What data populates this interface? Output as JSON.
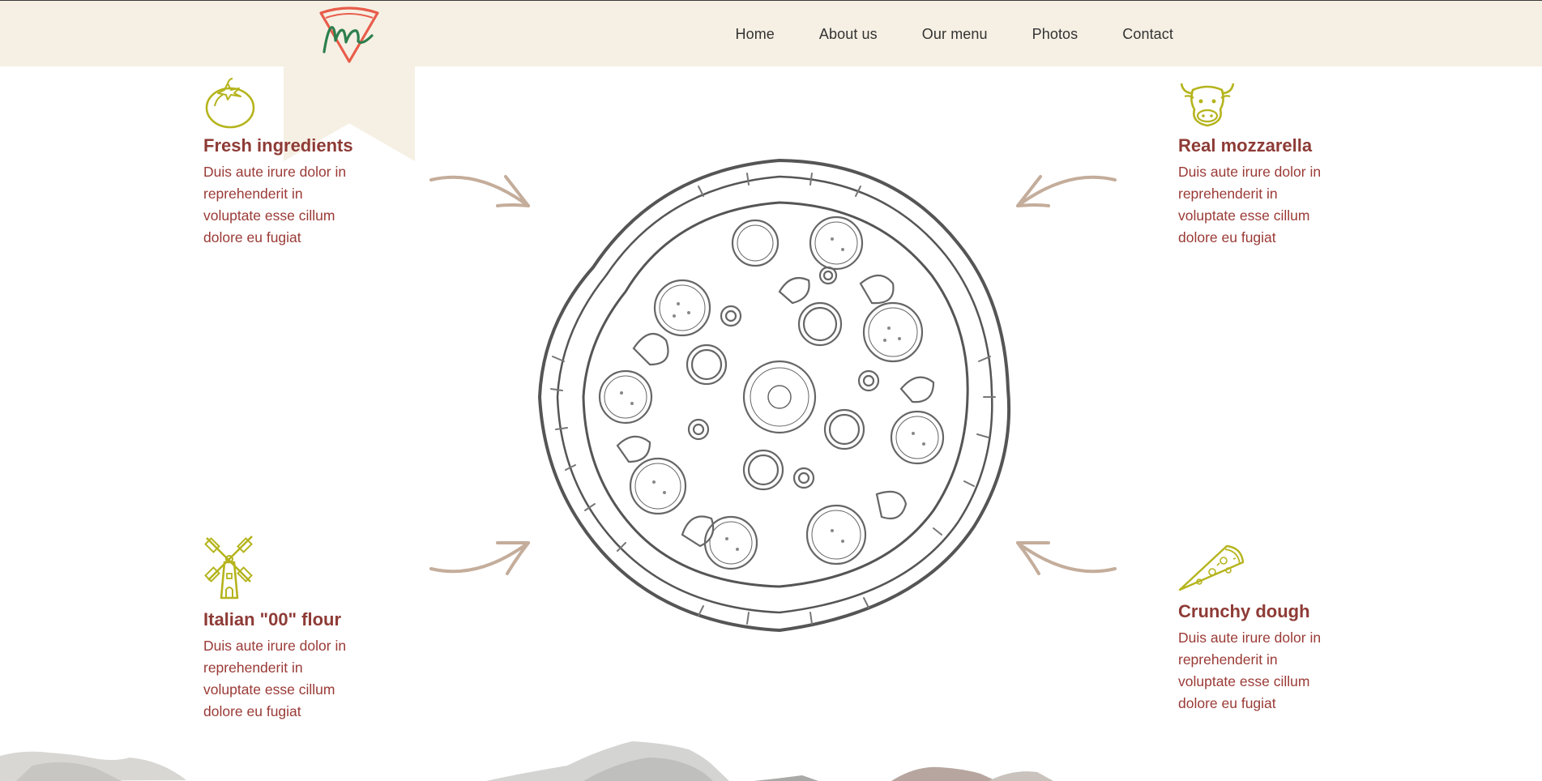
{
  "nav": {
    "items": [
      {
        "label": "Home"
      },
      {
        "label": "About us"
      },
      {
        "label": "Our menu"
      },
      {
        "label": "Photos"
      },
      {
        "label": "Contact"
      }
    ]
  },
  "features": [
    {
      "icon": "tomato-icon",
      "title": "Fresh ingredients",
      "text": "Duis aute irure dolor in reprehenderit in voluptate esse cillum dolore eu fugiat"
    },
    {
      "icon": "cow-icon",
      "title": "Real mozzarella",
      "text": "Duis aute irure dolor in reprehenderit in voluptate esse cillum dolore eu fugiat"
    },
    {
      "icon": "windmill-icon",
      "title": "Italian \"00\" flour",
      "text": "Duis aute irure dolor in reprehenderit in voluptate esse cillum dolore eu fugiat"
    },
    {
      "icon": "pizza-slice-icon",
      "title": "Crunchy dough",
      "text": "Duis aute irure dolor in reprehenderit in voluptate esse cillum dolore eu fugiat"
    }
  ],
  "colors": {
    "header_bg": "#f6f0e4",
    "heading": "#8e3b36",
    "body_text": "#9a3a36",
    "icon": "#b5b41d",
    "arrow": "#c4ad9b",
    "logo_red": "#e85c4a",
    "logo_green": "#2d7f4e"
  }
}
